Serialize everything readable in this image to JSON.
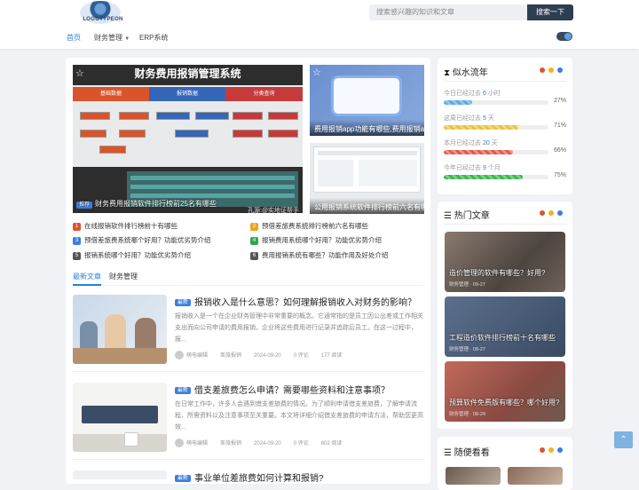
{
  "header": {
    "logo_text": "LOGOTYPEON",
    "search_placeholder": "搜索感兴趣的知识和文章",
    "search_button": "搜索一下",
    "nav": [
      {
        "label": "首页",
        "active": true
      },
      {
        "label": "财务管理",
        "dropdown": true
      },
      {
        "label": "ERP系统"
      }
    ]
  },
  "slider": {
    "main": {
      "screen_title": "财务费用报销管理系统",
      "tab1": "基础数据",
      "tab2": "报销数据",
      "tab3": "分类查询",
      "tag": "推荐",
      "caption": "财务费用报销软件排行榜前25名有哪些",
      "watermark": "孔源:@实地证帮手"
    },
    "side1": {
      "caption": "费用报销app功能有哪些,费用报销app"
    },
    "side2": {
      "caption": "公用报销系统软件排行榜前六名有哪些"
    }
  },
  "headlines": [
    {
      "n": "1",
      "text": "在线报销软件排行榜前十有哪些",
      "color": "#e0522f"
    },
    {
      "n": "2",
      "text": "预借差旅费系统排行榜前六名有哪些",
      "color": "#f0a21c"
    },
    {
      "n": "3",
      "text": "预借差旅费系统哪个好用？功能优劣势介绍",
      "color": "#3d7ee0"
    },
    {
      "n": "4",
      "text": "报销费用系统哪个好用？功能优劣势介绍",
      "color": "#2fa84f"
    },
    {
      "n": "5",
      "text": "报销系统哪个好用？功能优劣势介绍",
      "color": "#555"
    },
    {
      "n": "6",
      "text": "费用报销系统有哪些？功能作用及好处介绍",
      "color": "#555"
    }
  ],
  "tabs": [
    "最新文章",
    "财务管理"
  ],
  "articles": [
    {
      "cat": "最新",
      "title": "报销收入是什么意思？如何理解报销收入对财务的影响？",
      "desc": "报销收入是一个在企业财务管理中非常重要的概念。它通常指的是员工因公出差或工作相关支出而向公司申请的费用报销，企业将这些费用进行记录并追踪后员工。在这一过程中，报...",
      "author": "萌电编辑",
      "cat2": "差旅报销",
      "date": "2024-09-20",
      "comments": "0 评论",
      "views": "177 阅读"
    },
    {
      "cat": "最新",
      "title": "借支差旅费怎么申请？需要哪些资料和注意事项？",
      "desc": "在日常工作中，许多人会遇到借支差旅费的情况。为了顺利申请借支差旅费，了解申请流程、所需资料以及注意事项至关重要。本文将详细介绍借支差旅费的申请方法，帮助您更高效...",
      "author": "萌电编辑",
      "cat2": "差旅报销",
      "date": "2024-09-20",
      "comments": "0 评论",
      "views": "802 阅读"
    },
    {
      "cat": "最新",
      "title": "事业单位差旅费如何计算和报销?"
    }
  ],
  "sidebar": {
    "timeflow": {
      "title": "似水流年",
      "rows": [
        {
          "pre": "今日已经过去",
          "val": "6",
          "unit": "小时",
          "pct": 27,
          "pct_label": "27%",
          "color": "#5aa9e6"
        },
        {
          "pre": "这周已经过去",
          "val": "5",
          "unit": "天",
          "pct": 71,
          "pct_label": "71%",
          "color": "#e8c43a"
        },
        {
          "pre": "本月已经过去",
          "val": "20",
          "unit": "天",
          "pct": 66,
          "pct_label": "66%",
          "color": "#e05a4f"
        },
        {
          "pre": "今年已经过去",
          "val": "9",
          "unit": "个月",
          "pct": 75,
          "pct_label": "75%",
          "color": "#3ab54a"
        }
      ]
    },
    "hot": {
      "title": "热门文章",
      "items": [
        {
          "title": "造价管理的软件有哪些？好用?",
          "meta": "财务管理 · 09-27"
        },
        {
          "title": "工程造价软件排行榜前十名有哪些",
          "meta": "财务管理 · 08-27"
        },
        {
          "title": "预算软件免费版有哪些？哪个好用?",
          "meta": "财务管理 · 08-24"
        }
      ]
    },
    "random": {
      "title": "随便看看"
    }
  },
  "colors": {
    "accent": "#2a7ee0",
    "dot_red": "#e0522f",
    "dot_yellow": "#f0b323",
    "dot_blue": "#3d7ee0"
  }
}
